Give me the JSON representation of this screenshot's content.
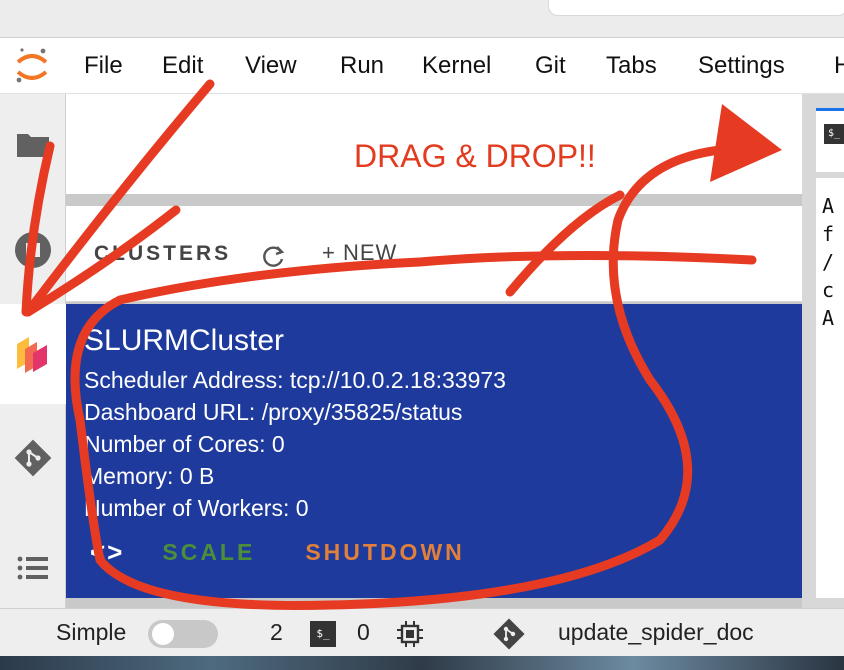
{
  "menubar": {
    "items": [
      "File",
      "Edit",
      "View",
      "Run",
      "Kernel",
      "Git",
      "Tabs",
      "Settings",
      "H"
    ]
  },
  "annotation": {
    "text": "DRAG & DROP!!",
    "color": "#e23b1f"
  },
  "clusters": {
    "title": "CLUSTERS",
    "new_label": "+ NEW",
    "card": {
      "name": "SLURMCluster",
      "scheduler_address": "Scheduler Address: tcp://10.0.2.18:33973",
      "dashboard_url": "Dashboard URL: /proxy/35825/status",
      "cores": "Number of Cores: 0",
      "memory": "Memory: 0 B",
      "workers": "Number of Workers: 0",
      "code_label": "<>",
      "scale_label": "SCALE",
      "shutdown_label": "SHUTDOWN",
      "background_color": "#1e3a9c"
    }
  },
  "terminal": {
    "tab_icon": "$_",
    "lines": [
      "A",
      "f",
      "/",
      "c",
      "A"
    ]
  },
  "statusbar": {
    "mode_label": "Simple",
    "terminal_count": "2",
    "terminal_icon": "$_",
    "kernel_count": "0",
    "branch": "update_spider_doc"
  },
  "icons": {
    "activity": [
      "folder-icon",
      "running-icon",
      "dask-icon",
      "git-icon",
      "toc-icon"
    ]
  }
}
